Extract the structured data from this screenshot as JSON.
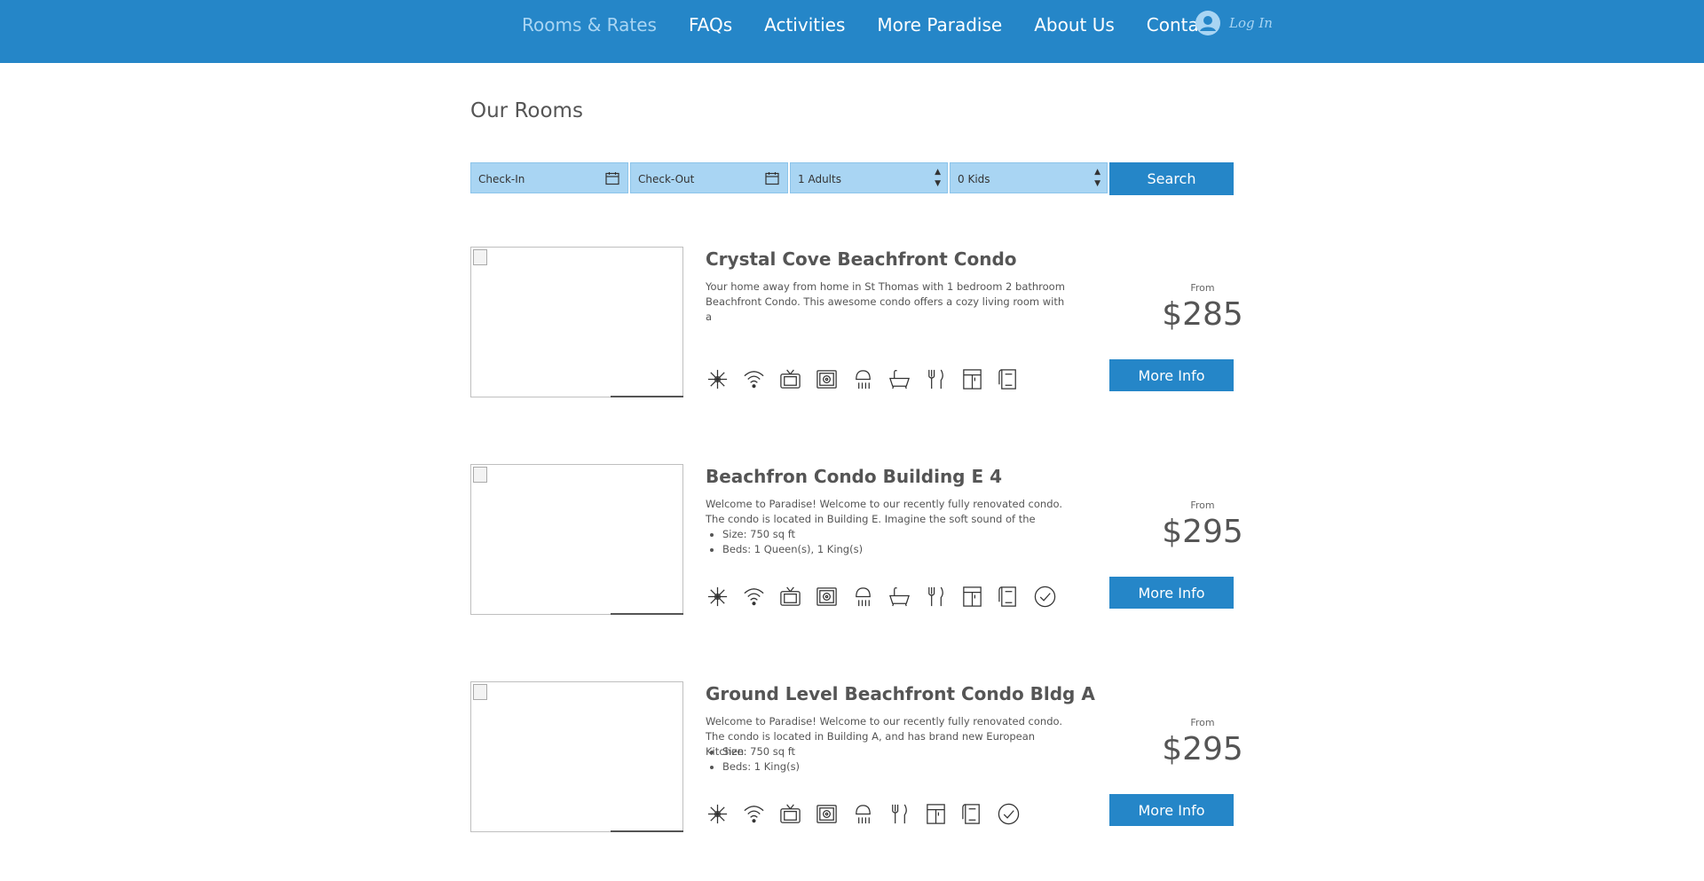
{
  "nav": {
    "items": [
      "Rooms & Rates",
      "FAQs",
      "Activities",
      "More Paradise",
      "About Us",
      "Contact"
    ],
    "login": "Log In"
  },
  "page_title": "Our Rooms",
  "search": {
    "checkin": "Check-In",
    "checkout": "Check-Out",
    "adults": "1 Adults",
    "kids": "0 Kids",
    "button": "Search"
  },
  "rooms": [
    {
      "title": "Crystal Cove Beachfront Condo",
      "desc": "Your home away from home in St Thomas with 1 bedroom 2 bathroom Beachfront Condo. This awesome condo offers a cozy living room with a",
      "from": "From",
      "price": "$285",
      "button": "More Info"
    },
    {
      "title": "Beachfron Condo Building E 4",
      "desc": "Welcome to Paradise! Welcome to our recently fully renovated condo. The condo is located in Building E. Imagine the soft sound of the",
      "bullets": [
        "Size: 750 sq ft",
        "Beds: 1 Queen(s), 1 King(s)"
      ],
      "from": "From",
      "price": "$295",
      "button": "More Info"
    },
    {
      "title": "Ground Level Beachfront Condo Bldg A",
      "desc": "Welcome to Paradise! Welcome to our recently fully renovated condo. The condo is located in Building A, and has brand new European Kitchen",
      "bullets": [
        "Size: 750 sq ft",
        "Beds: 1 King(s)"
      ],
      "from": "From",
      "price": "$295",
      "button": "More Info"
    }
  ],
  "colors": {
    "brand": "#2586c8",
    "field": "#a9d5f3"
  }
}
